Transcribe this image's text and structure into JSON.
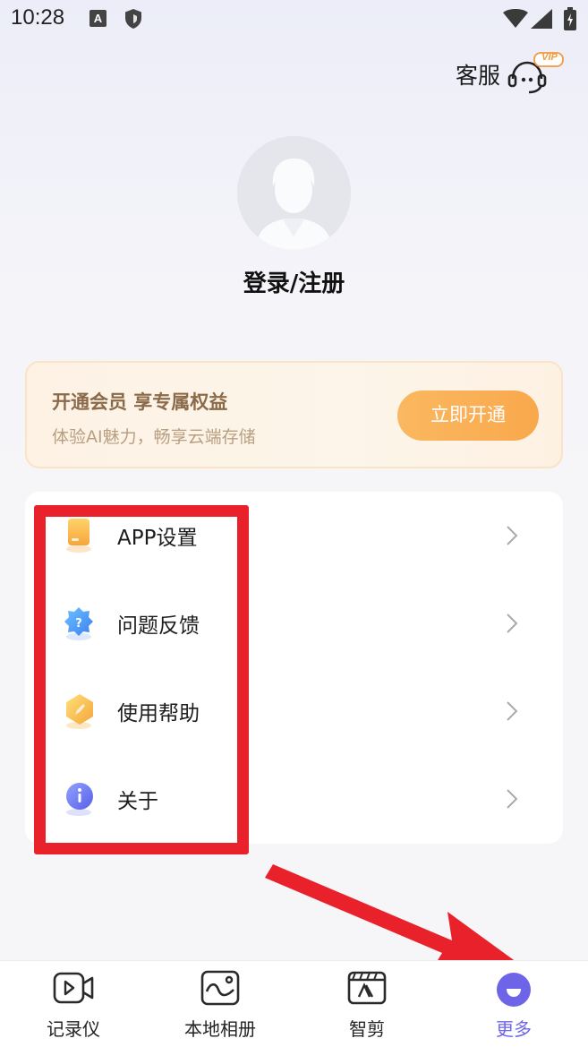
{
  "status_bar": {
    "time": "10:28",
    "a_badge": "A"
  },
  "header": {
    "customer_service_label": "客服",
    "vip_badge": "VIP"
  },
  "profile": {
    "login_text": "登录/注册"
  },
  "vip_card": {
    "title": "开通会员 享专属权益",
    "subtitle": "体验AI魅力，畅享云端存储",
    "button_label": "立即开通"
  },
  "menu": {
    "items": [
      {
        "label": "APP设置",
        "icon": "app-settings-icon"
      },
      {
        "label": "问题反馈",
        "icon": "feedback-icon"
      },
      {
        "label": "使用帮助",
        "icon": "help-icon"
      },
      {
        "label": "关于",
        "icon": "about-icon"
      }
    ]
  },
  "bottom_nav": {
    "items": [
      {
        "label": "记录仪",
        "icon": "recorder-icon"
      },
      {
        "label": "本地相册",
        "icon": "album-icon"
      },
      {
        "label": "智剪",
        "icon": "smart-cut-icon"
      },
      {
        "label": "更多",
        "icon": "more-icon"
      }
    ],
    "active_index": 3
  },
  "colors": {
    "accent": "#6e64e8",
    "vip_button": "#f9a84c",
    "annotation": "#e8212b"
  }
}
